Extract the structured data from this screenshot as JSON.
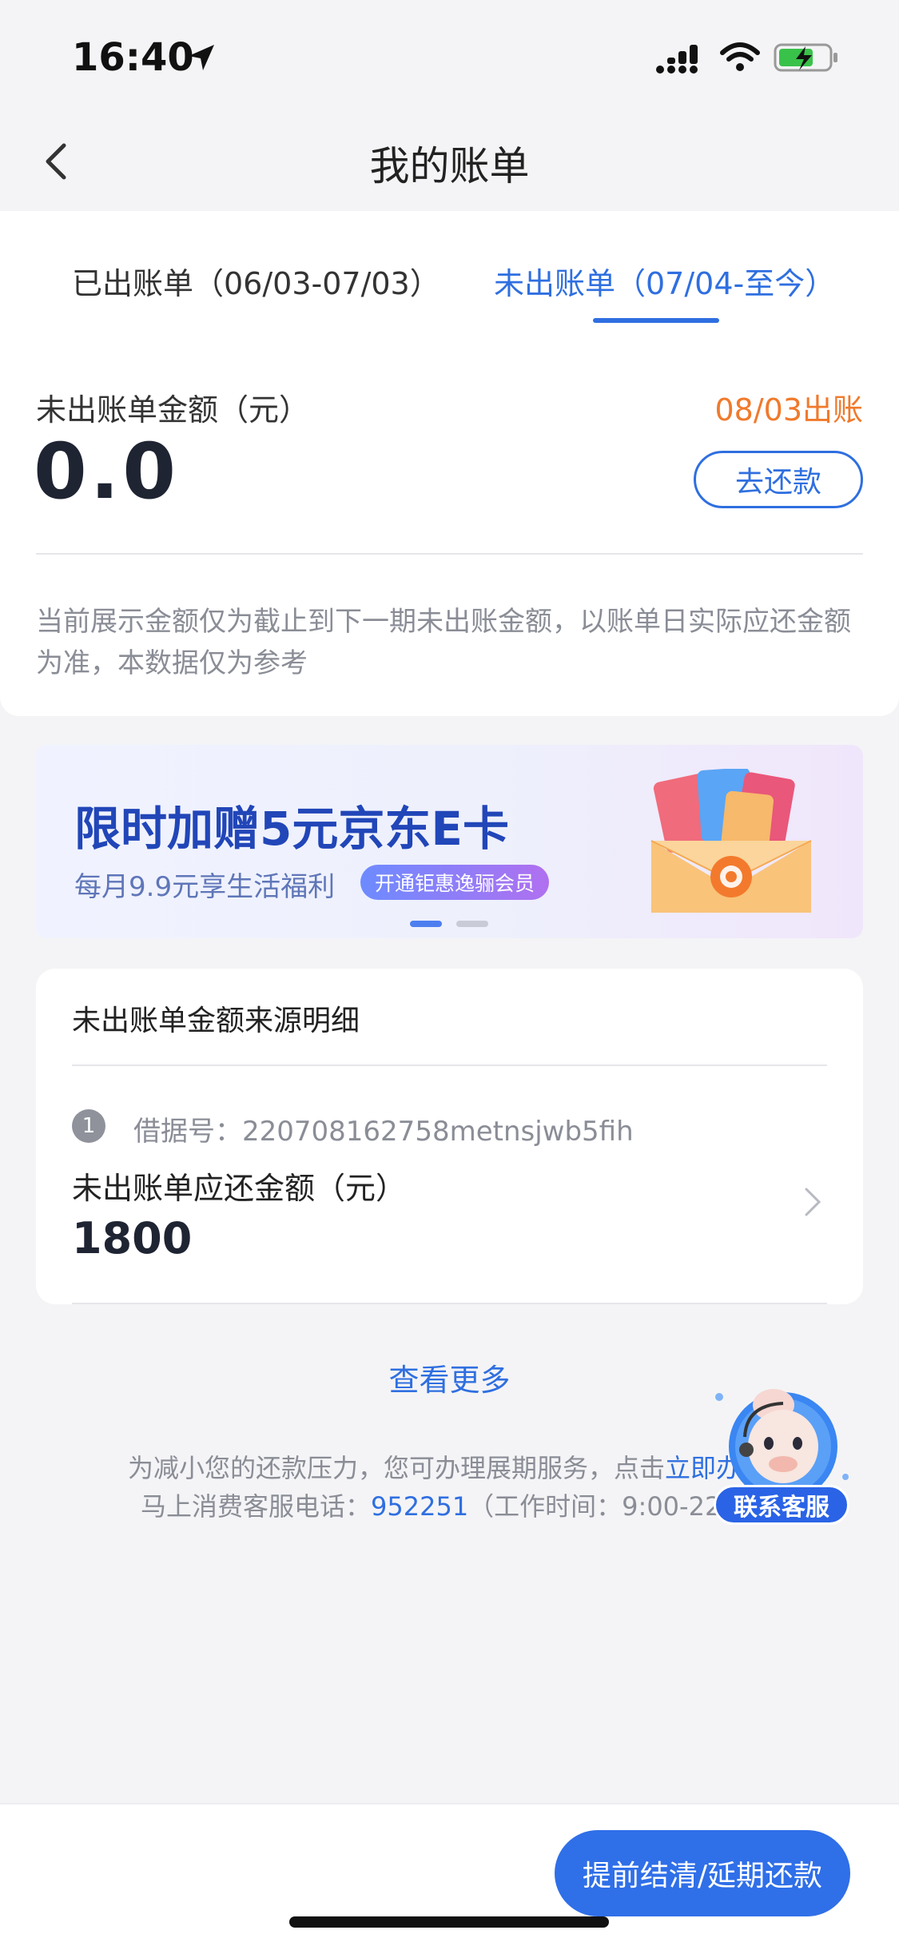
{
  "status_bar": {
    "time": "16:40"
  },
  "nav": {
    "title": "我的账单"
  },
  "tabs": [
    {
      "label": "已出账单（06/03-07/03）",
      "active": false
    },
    {
      "label": "未出账单（07/04-至今）",
      "active": true
    }
  ],
  "summary": {
    "amount_label": "未出账单金额（元）",
    "due_date": "08/03出账",
    "amount": "0.0",
    "repay_button": "去还款",
    "notice": "当前展示金额仅为截止到下一期未出账金额，以账单日实际应还金额为准，本数据仅为参考"
  },
  "banner": {
    "headline": "限时加赠5元京东E卡",
    "subline": "每月9.9元享生活福利",
    "pill": "开通钜惠逸骊会员",
    "active_slide": 1,
    "slide_count": 2
  },
  "detail": {
    "title": "未出账单金额来源明细",
    "loans": [
      {
        "index": "1",
        "loan_no_label": "借据号：",
        "loan_no": "220708162758metnsjwb5fih",
        "amount_label": "未出账单应还金额（元）",
        "amount": "1800"
      }
    ]
  },
  "view_more": "查看更多",
  "footer": {
    "line1_text": "为减小您的还款压力，您可办理展期服务，点击",
    "line1_link": "立即办",
    "line2_prefix": "马上消费客服电话：",
    "phone": "952251",
    "line2_suffix": "（工作时间：9:00-22:0"
  },
  "customer_service": {
    "label": "联系客服"
  },
  "bottom": {
    "prepay_button": "提前结清/延期还款"
  },
  "colors": {
    "accent": "#2f6fe0",
    "warning": "#f07a2c",
    "page_bg": "#f4f4f6"
  }
}
